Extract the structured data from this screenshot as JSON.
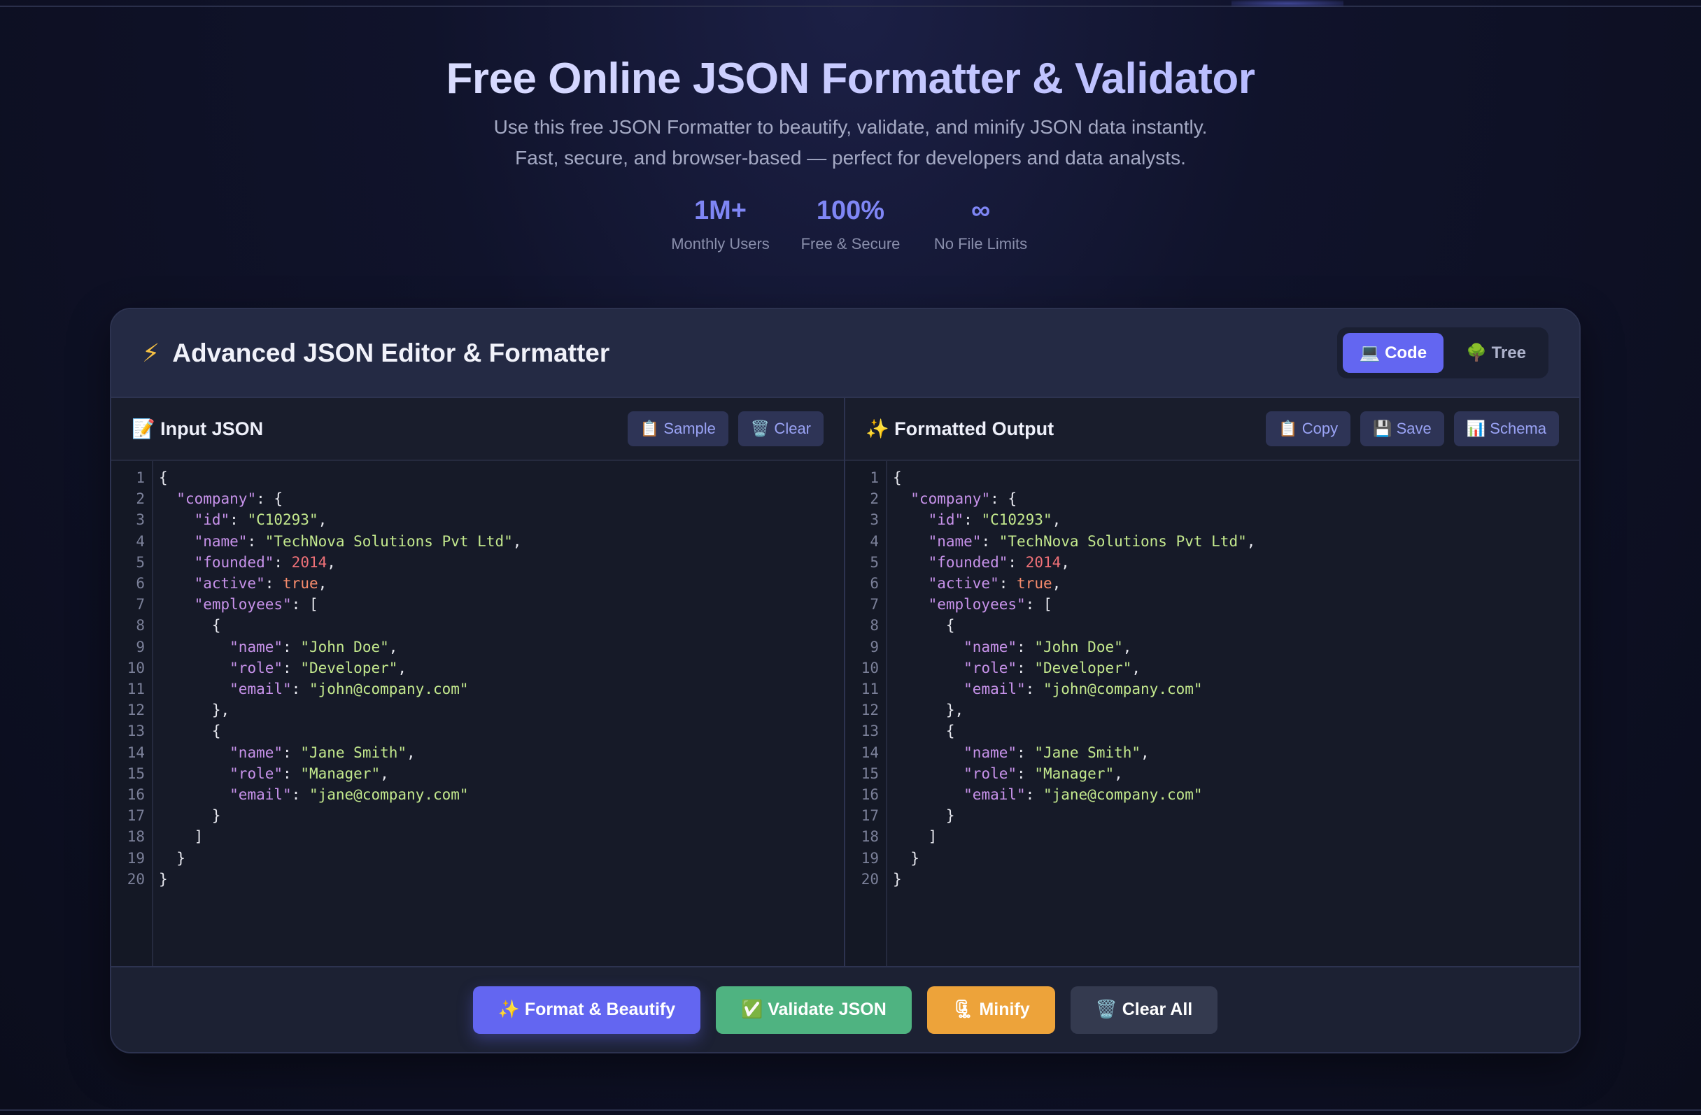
{
  "hero": {
    "title": "Free Online JSON Formatter & Validator",
    "subtitle_line1": "Use this free JSON Formatter to beautify, validate, and minify JSON data instantly.",
    "subtitle_line2": "Fast, secure, and browser-based — perfect for developers and data analysts."
  },
  "stats": [
    {
      "value": "1M+",
      "label": "Monthly Users"
    },
    {
      "value": "100%",
      "label": "Free & Secure"
    },
    {
      "value": "∞",
      "label": "No File Limits"
    }
  ],
  "editor": {
    "title": "Advanced JSON Editor & Formatter",
    "title_icon": "⚡",
    "view_toggle": [
      {
        "label": "💻 Code",
        "active": true
      },
      {
        "label": "🌳 Tree",
        "active": false
      }
    ]
  },
  "input_panel": {
    "title": "📝 Input JSON",
    "buttons": [
      "📋 Sample",
      "🗑️ Clear"
    ]
  },
  "output_panel": {
    "title": "✨ Formatted Output",
    "buttons": [
      "📋 Copy",
      "💾 Save",
      "📊 Schema"
    ]
  },
  "json_lines": [
    [
      [
        "p",
        "{"
      ]
    ],
    [
      [
        "p",
        "  "
      ],
      [
        "k",
        "\"company\""
      ],
      [
        "p",
        ": {"
      ]
    ],
    [
      [
        "p",
        "    "
      ],
      [
        "k",
        "\"id\""
      ],
      [
        "p",
        ": "
      ],
      [
        "s",
        "\"C10293\""
      ],
      [
        "p",
        ","
      ]
    ],
    [
      [
        "p",
        "    "
      ],
      [
        "k",
        "\"name\""
      ],
      [
        "p",
        ": "
      ],
      [
        "s",
        "\"TechNova Solutions Pvt Ltd\""
      ],
      [
        "p",
        ","
      ]
    ],
    [
      [
        "p",
        "    "
      ],
      [
        "k",
        "\"founded\""
      ],
      [
        "p",
        ": "
      ],
      [
        "n",
        "2014"
      ],
      [
        "p",
        ","
      ]
    ],
    [
      [
        "p",
        "    "
      ],
      [
        "k",
        "\"active\""
      ],
      [
        "p",
        ": "
      ],
      [
        "b",
        "true"
      ],
      [
        "p",
        ","
      ]
    ],
    [
      [
        "p",
        "    "
      ],
      [
        "k",
        "\"employees\""
      ],
      [
        "p",
        ": ["
      ]
    ],
    [
      [
        "p",
        "      {"
      ]
    ],
    [
      [
        "p",
        "        "
      ],
      [
        "k",
        "\"name\""
      ],
      [
        "p",
        ": "
      ],
      [
        "s",
        "\"John Doe\""
      ],
      [
        "p",
        ","
      ]
    ],
    [
      [
        "p",
        "        "
      ],
      [
        "k",
        "\"role\""
      ],
      [
        "p",
        ": "
      ],
      [
        "s",
        "\"Developer\""
      ],
      [
        "p",
        ","
      ]
    ],
    [
      [
        "p",
        "        "
      ],
      [
        "k",
        "\"email\""
      ],
      [
        "p",
        ": "
      ],
      [
        "s",
        "\"john@company.com\""
      ]
    ],
    [
      [
        "p",
        "      },"
      ]
    ],
    [
      [
        "p",
        "      {"
      ]
    ],
    [
      [
        "p",
        "        "
      ],
      [
        "k",
        "\"name\""
      ],
      [
        "p",
        ": "
      ],
      [
        "s",
        "\"Jane Smith\""
      ],
      [
        "p",
        ","
      ]
    ],
    [
      [
        "p",
        "        "
      ],
      [
        "k",
        "\"role\""
      ],
      [
        "p",
        ": "
      ],
      [
        "s",
        "\"Manager\""
      ],
      [
        "p",
        ","
      ]
    ],
    [
      [
        "p",
        "        "
      ],
      [
        "k",
        "\"email\""
      ],
      [
        "p",
        ": "
      ],
      [
        "s",
        "\"jane@company.com\""
      ]
    ],
    [
      [
        "p",
        "      }"
      ]
    ],
    [
      [
        "p",
        "    ]"
      ]
    ],
    [
      [
        "p",
        "  }"
      ]
    ],
    [
      [
        "p",
        "}"
      ]
    ]
  ],
  "actions": [
    {
      "label": "✨ Format & Beautify",
      "kind": "format"
    },
    {
      "label": "✅ Validate JSON",
      "kind": "validate"
    },
    {
      "label": "🗜 Minify",
      "kind": "minify"
    },
    {
      "label": "🗑️ Clear All",
      "kind": "clear"
    }
  ],
  "colors": {
    "accent": "#6366f1",
    "validate": "#4fb381",
    "minify": "#eda33a",
    "json_key": "#c792ea",
    "json_string": "#c3e88d",
    "json_number": "#f07178",
    "json_bool": "#f78c6c"
  }
}
